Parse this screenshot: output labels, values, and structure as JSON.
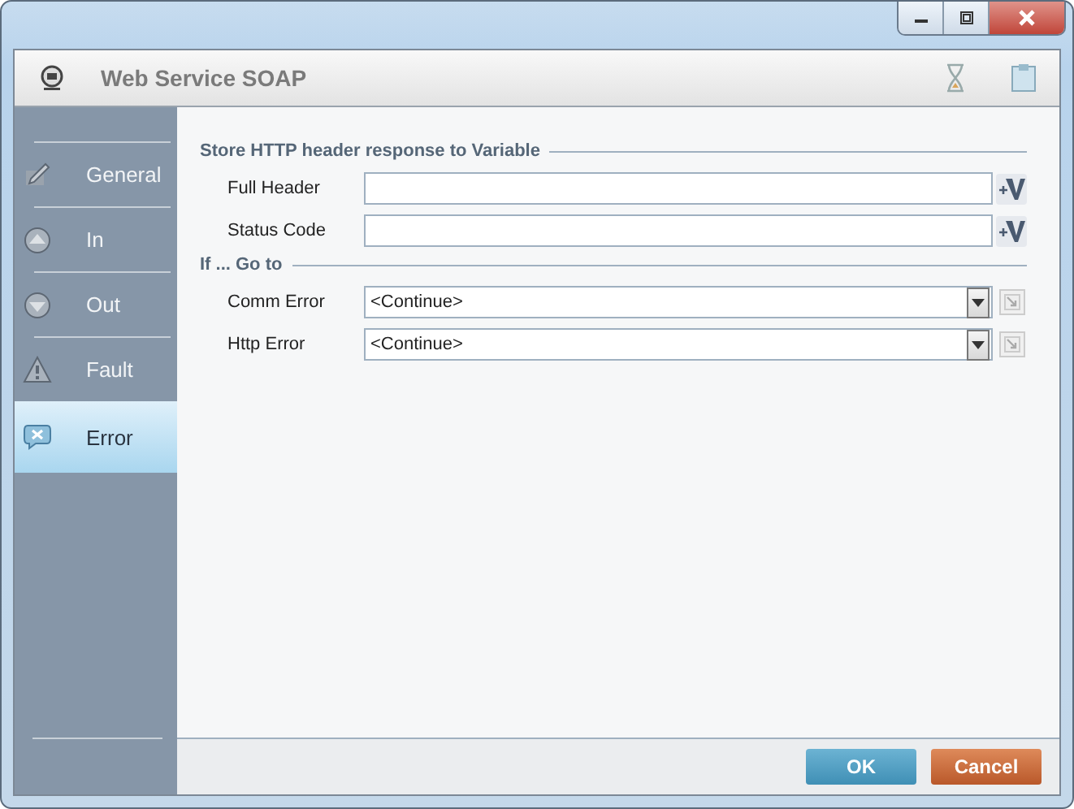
{
  "window": {
    "title": "Web Service SOAP"
  },
  "sidebar": {
    "items": [
      {
        "label": "General",
        "selected": false
      },
      {
        "label": "In",
        "selected": false
      },
      {
        "label": "Out",
        "selected": false
      },
      {
        "label": "Fault",
        "selected": false
      },
      {
        "label": "Error",
        "selected": true
      }
    ]
  },
  "sections": [
    {
      "title": "Store HTTP header response to Variable",
      "rows": [
        {
          "kind": "variable",
          "label": "Full Header",
          "value": ""
        },
        {
          "kind": "variable",
          "label": "Status Code",
          "value": ""
        }
      ]
    },
    {
      "title": "If ... Go to",
      "rows": [
        {
          "kind": "dropdown",
          "label": "Comm Error",
          "value": "<Continue>"
        },
        {
          "kind": "dropdown",
          "label": "Http Error",
          "value": "<Continue>"
        }
      ]
    }
  ],
  "buttons": [
    {
      "label": "OK",
      "kind": "primary"
    },
    {
      "label": "Cancel",
      "kind": "cancel"
    }
  ]
}
